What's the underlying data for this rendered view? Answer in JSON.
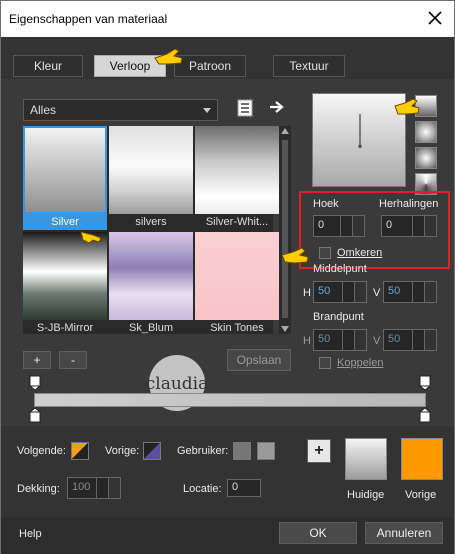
{
  "window": {
    "title": "Eigenschappen van materiaal",
    "close_label": "×"
  },
  "tabs": [
    {
      "label": "Kleur"
    },
    {
      "label": "Verloop"
    },
    {
      "label": "Patroon"
    },
    {
      "label": "Textuur"
    }
  ],
  "filter": {
    "selected": "Alles"
  },
  "gradients": [
    {
      "label": "Silver",
      "selected": true
    },
    {
      "label": "silvers"
    },
    {
      "label": "Silver-Whit..."
    },
    {
      "label": "S-JB-Mirror"
    },
    {
      "label": "Sk_Blum"
    },
    {
      "label": "Skin Tones"
    }
  ],
  "buttons": {
    "add": "+",
    "remove": "-",
    "save": "Opslaan",
    "ok": "OK",
    "cancel": "Annuleren",
    "help": "Help",
    "plus": "+"
  },
  "settings": {
    "hoek_label": "Hoek",
    "hoek_value": "0",
    "herhalingen_label": "Herhalingen",
    "herhalingen_value": "0",
    "omkeren_label": "Omkeren",
    "middelpunt_label": "Middelpunt",
    "middelpunt_h_label": "H",
    "middelpunt_h_value": "50",
    "middelpunt_v_label": "V",
    "middelpunt_v_value": "50",
    "brandpunt_label": "Brandpunt",
    "brandpunt_h_label": "H",
    "brandpunt_h_value": "50",
    "brandpunt_v_label": "V",
    "brandpunt_v_value": "50",
    "koppelen_label": "Koppelen"
  },
  "bottom": {
    "volgende_label": "Volgende:",
    "vorige_label": "Vorige:",
    "gebruiker_label": "Gebruiker:",
    "dekking_label": "Dekking:",
    "dekking_value": "100",
    "locatie_label": "Locatie:",
    "locatie_value": "0",
    "huidige_label": "Huidige",
    "vorige_swatch_label": "Vorige"
  },
  "watermark": {
    "text": "claudia"
  },
  "colors": {
    "accent": "#3996e0",
    "highlight": "#e31e24",
    "orange": "#ff9900",
    "volgende_swatch": "#ff9a1a",
    "vorige_swatch": "#5a4fa0"
  }
}
